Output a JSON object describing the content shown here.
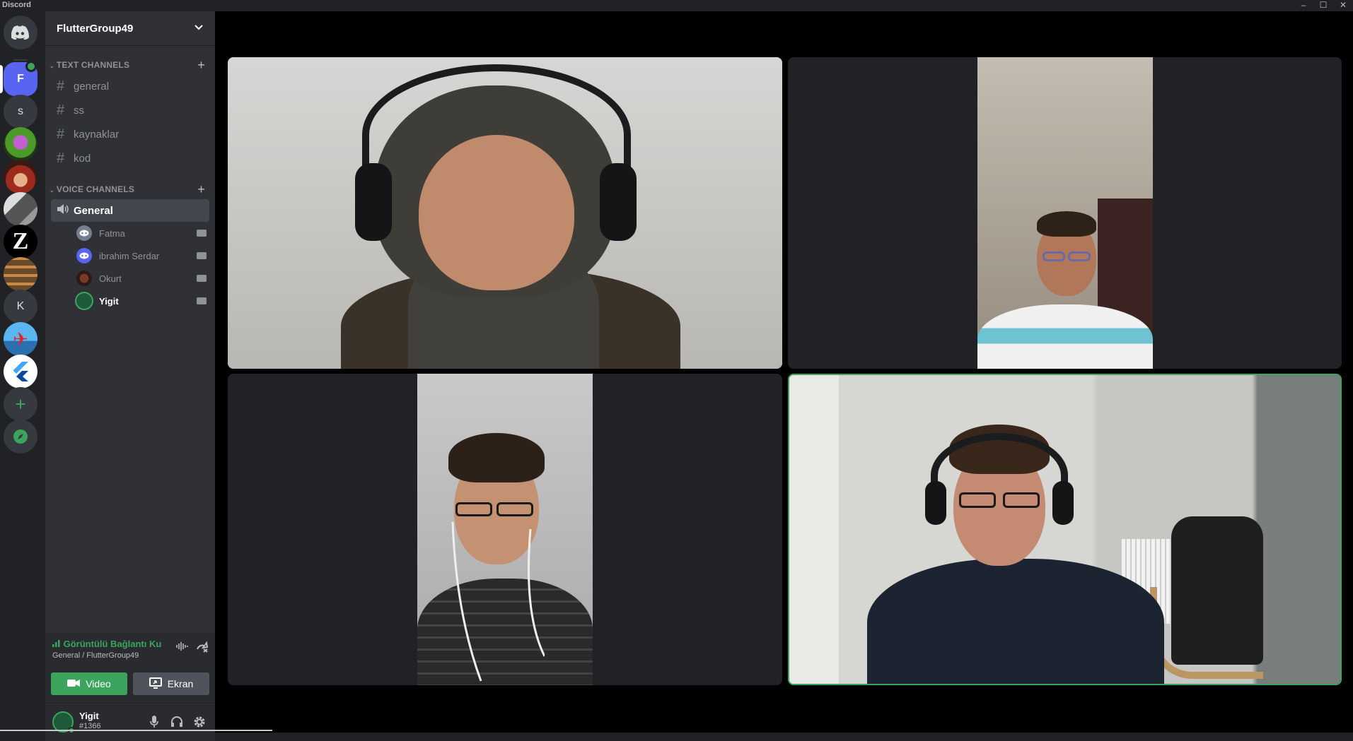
{
  "window": {
    "app_name": "Discord"
  },
  "rail": {
    "home_icon": "discord-logo-icon",
    "servers": [
      "F",
      "s",
      "K"
    ],
    "add_icon": "plus-icon",
    "explore_icon": "compass-icon"
  },
  "guild": {
    "name": "FlutterGroup49"
  },
  "text_category": {
    "label": "TEXT CHANNELS"
  },
  "text_channels": [
    "general",
    "ss",
    "kaynaklar",
    "kod"
  ],
  "voice_category": {
    "label": "VOICE CHANNELS"
  },
  "voice_channel": {
    "name": "General"
  },
  "voice_users": [
    "Fatma",
    "ibrahim Serdar",
    "Okurt",
    "Yigit"
  ],
  "voice_panel": {
    "status": "Görüntülü Bağlantı Ku",
    "location": "General / FlutterGroup49",
    "video_label": "Video",
    "screen_label": "Ekran"
  },
  "user": {
    "name": "Yigit",
    "tag": "#1366"
  },
  "colors": {
    "accent": "#5865f2",
    "online": "#3ba55d",
    "speaking": "#3ba55d"
  }
}
